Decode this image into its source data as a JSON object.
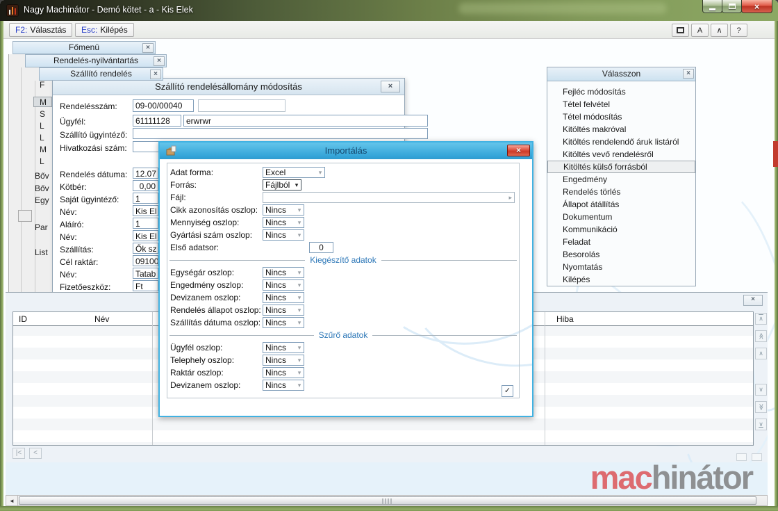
{
  "titlebar": {
    "title": "Nagy Machinátor - Demó kötet - a - Kis Elek"
  },
  "icons": {
    "close": "×",
    "min": "–",
    "dropdown_arrow": "▾",
    "file_arrow": "▸",
    "check": "✓",
    "up": "∧",
    "down": "∨",
    "double_up": "≪",
    "double_down": "≫",
    "first": "|<",
    "prev": "<",
    "left_arrow": "◄",
    "letter_a": "A",
    "caret": "∧",
    "help": "?"
  },
  "toolbar": {
    "buttons": [
      {
        "hotkey": "F2:",
        "label": "Választás"
      },
      {
        "hotkey": "Esc:",
        "label": "Kilépés"
      }
    ]
  },
  "cascade_windows": [
    {
      "title": "Főmenü"
    },
    {
      "title": "Rendelés-nyilvántartás"
    },
    {
      "title": "Szállító rendelés"
    }
  ],
  "background_fragments": {
    "letters": [
      "F",
      "M",
      "S",
      "L",
      "L",
      "M",
      "L"
    ],
    "words": [
      "Bőv",
      "Bőv",
      "Egy",
      "Par",
      "List"
    ]
  },
  "order_dialog": {
    "title": "Szállító rendelésállomány módosítás",
    "rows": [
      {
        "label": "Rendelésszám:",
        "value": "09-00/00040",
        "value2": ""
      },
      {
        "label": "Ügyfél:",
        "value": "61111128",
        "value2": "erwrwr"
      },
      {
        "label": "Szállító ügyintéző:",
        "value": ""
      },
      {
        "label": "Hivatkozási szám:",
        "value": ""
      },
      {
        "label": "Rendelés dátuma:",
        "value": "12.07"
      },
      {
        "label": "Kötbér:",
        "value": "0,00"
      },
      {
        "label": "Saját ügyintéző:",
        "value": "1"
      },
      {
        "label": "Név:",
        "value": "Kis El"
      },
      {
        "label": "Aláíró:",
        "value": "1"
      },
      {
        "label": "Név:",
        "value": "Kis El"
      },
      {
        "label": "Szállítás:",
        "value": "Ők sz"
      },
      {
        "label": "Cél raktár:",
        "value": "09100"
      },
      {
        "label": "Név:",
        "value": "Tatab"
      },
      {
        "label": "Fizetőeszköz:",
        "value": "Ft"
      }
    ]
  },
  "import_dialog": {
    "title": "Importálás",
    "sections": [
      "Kiegészítő adatok",
      "Szűrő adatok"
    ],
    "rows": [
      {
        "label": "Adat forma:",
        "value": "Excel"
      },
      {
        "label": "Forrás:",
        "value": "Fájlból"
      },
      {
        "label": "Fájl:",
        "value": ""
      },
      {
        "label": "Cikk azonosítás oszlop:",
        "value": "Nincs"
      },
      {
        "label": "Mennyiség oszlop:",
        "value": "Nincs"
      },
      {
        "label": "Gyártási szám oszlop:",
        "value": "Nincs"
      },
      {
        "label": "Első adatsor:",
        "value": "0"
      },
      {
        "label": "Egységár oszlop:",
        "value": "Nincs"
      },
      {
        "label": "Engedmény oszlop:",
        "value": "Nincs"
      },
      {
        "label": "Devizanem oszlop:",
        "value": "Nincs"
      },
      {
        "label": "Rendelés állapot oszlop:",
        "value": "Nincs"
      },
      {
        "label": "Szállítás dátuma oszlop:",
        "value": "Nincs"
      },
      {
        "label": "Ügyfél oszlop:",
        "value": "Nincs"
      },
      {
        "label": "Telephely oszlop:",
        "value": "Nincs"
      },
      {
        "label": "Raktár oszlop:",
        "value": "Nincs"
      },
      {
        "label": "Devizanem oszlop:",
        "value": "Nincs"
      }
    ]
  },
  "choose_panel": {
    "title": "Válasszon",
    "items": [
      {
        "label": "Fejléc módosítás"
      },
      {
        "label": "Tétel felvétel"
      },
      {
        "label": "Tétel módosítás"
      },
      {
        "label": "Kitöltés makróval"
      },
      {
        "label": "Kitöltés rendelendő áruk listáról"
      },
      {
        "label": "Kitöltés vevő rendelésről"
      },
      {
        "label": "Kitöltés külső forrásból"
      },
      {
        "label": "Engedmény"
      },
      {
        "label": "Rendelés törlés"
      },
      {
        "label": "Állapot átállítás"
      },
      {
        "label": "Dokumentum"
      },
      {
        "label": "Kommunikáció"
      },
      {
        "label": "Feladat"
      },
      {
        "label": "Besorolás"
      },
      {
        "label": "Nyomtatás"
      },
      {
        "label": "Kilépés"
      }
    ]
  },
  "bottom_panel": {
    "columns": [
      {
        "label": "ID"
      },
      {
        "label": "Név"
      },
      {
        "label": "Hiba"
      }
    ]
  },
  "logo": {
    "part1": "mac",
    "part2": "hinátor",
    "red": "#dd6b70",
    "gray": "#8e9092"
  },
  "colors": {
    "accent_blue": "#41b2e2",
    "close_red": "#cc3a28",
    "title_green": "#6d8049"
  }
}
